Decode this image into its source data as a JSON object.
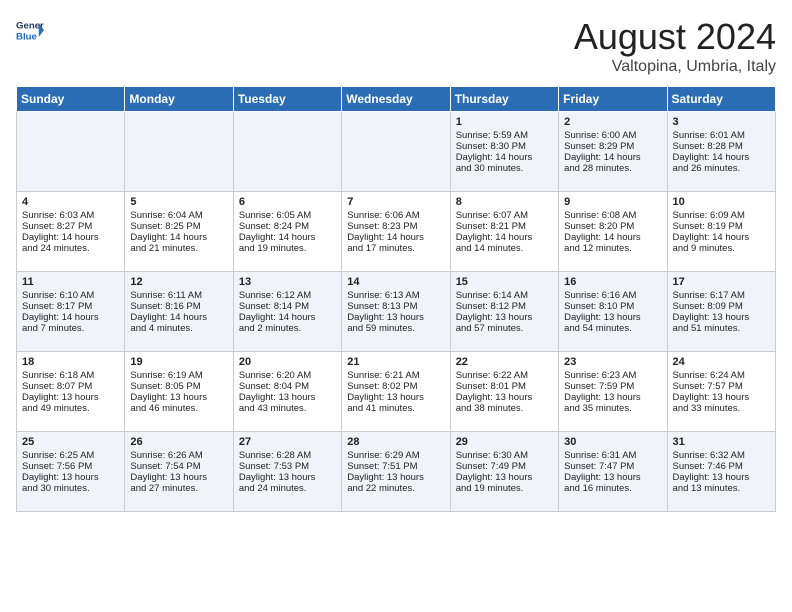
{
  "header": {
    "logo_line1": "General",
    "logo_line2": "Blue",
    "title": "August 2024",
    "subtitle": "Valtopina, Umbria, Italy"
  },
  "weekdays": [
    "Sunday",
    "Monday",
    "Tuesday",
    "Wednesday",
    "Thursday",
    "Friday",
    "Saturday"
  ],
  "weeks": [
    [
      {
        "day": "",
        "lines": []
      },
      {
        "day": "",
        "lines": []
      },
      {
        "day": "",
        "lines": []
      },
      {
        "day": "",
        "lines": []
      },
      {
        "day": "1",
        "lines": [
          "Sunrise: 5:59 AM",
          "Sunset: 8:30 PM",
          "Daylight: 14 hours",
          "and 30 minutes."
        ]
      },
      {
        "day": "2",
        "lines": [
          "Sunrise: 6:00 AM",
          "Sunset: 8:29 PM",
          "Daylight: 14 hours",
          "and 28 minutes."
        ]
      },
      {
        "day": "3",
        "lines": [
          "Sunrise: 6:01 AM",
          "Sunset: 8:28 PM",
          "Daylight: 14 hours",
          "and 26 minutes."
        ]
      }
    ],
    [
      {
        "day": "4",
        "lines": [
          "Sunrise: 6:03 AM",
          "Sunset: 8:27 PM",
          "Daylight: 14 hours",
          "and 24 minutes."
        ]
      },
      {
        "day": "5",
        "lines": [
          "Sunrise: 6:04 AM",
          "Sunset: 8:25 PM",
          "Daylight: 14 hours",
          "and 21 minutes."
        ]
      },
      {
        "day": "6",
        "lines": [
          "Sunrise: 6:05 AM",
          "Sunset: 8:24 PM",
          "Daylight: 14 hours",
          "and 19 minutes."
        ]
      },
      {
        "day": "7",
        "lines": [
          "Sunrise: 6:06 AM",
          "Sunset: 8:23 PM",
          "Daylight: 14 hours",
          "and 17 minutes."
        ]
      },
      {
        "day": "8",
        "lines": [
          "Sunrise: 6:07 AM",
          "Sunset: 8:21 PM",
          "Daylight: 14 hours",
          "and 14 minutes."
        ]
      },
      {
        "day": "9",
        "lines": [
          "Sunrise: 6:08 AM",
          "Sunset: 8:20 PM",
          "Daylight: 14 hours",
          "and 12 minutes."
        ]
      },
      {
        "day": "10",
        "lines": [
          "Sunrise: 6:09 AM",
          "Sunset: 8:19 PM",
          "Daylight: 14 hours",
          "and 9 minutes."
        ]
      }
    ],
    [
      {
        "day": "11",
        "lines": [
          "Sunrise: 6:10 AM",
          "Sunset: 8:17 PM",
          "Daylight: 14 hours",
          "and 7 minutes."
        ]
      },
      {
        "day": "12",
        "lines": [
          "Sunrise: 6:11 AM",
          "Sunset: 8:16 PM",
          "Daylight: 14 hours",
          "and 4 minutes."
        ]
      },
      {
        "day": "13",
        "lines": [
          "Sunrise: 6:12 AM",
          "Sunset: 8:14 PM",
          "Daylight: 14 hours",
          "and 2 minutes."
        ]
      },
      {
        "day": "14",
        "lines": [
          "Sunrise: 6:13 AM",
          "Sunset: 8:13 PM",
          "Daylight: 13 hours",
          "and 59 minutes."
        ]
      },
      {
        "day": "15",
        "lines": [
          "Sunrise: 6:14 AM",
          "Sunset: 8:12 PM",
          "Daylight: 13 hours",
          "and 57 minutes."
        ]
      },
      {
        "day": "16",
        "lines": [
          "Sunrise: 6:16 AM",
          "Sunset: 8:10 PM",
          "Daylight: 13 hours",
          "and 54 minutes."
        ]
      },
      {
        "day": "17",
        "lines": [
          "Sunrise: 6:17 AM",
          "Sunset: 8:09 PM",
          "Daylight: 13 hours",
          "and 51 minutes."
        ]
      }
    ],
    [
      {
        "day": "18",
        "lines": [
          "Sunrise: 6:18 AM",
          "Sunset: 8:07 PM",
          "Daylight: 13 hours",
          "and 49 minutes."
        ]
      },
      {
        "day": "19",
        "lines": [
          "Sunrise: 6:19 AM",
          "Sunset: 8:05 PM",
          "Daylight: 13 hours",
          "and 46 minutes."
        ]
      },
      {
        "day": "20",
        "lines": [
          "Sunrise: 6:20 AM",
          "Sunset: 8:04 PM",
          "Daylight: 13 hours",
          "and 43 minutes."
        ]
      },
      {
        "day": "21",
        "lines": [
          "Sunrise: 6:21 AM",
          "Sunset: 8:02 PM",
          "Daylight: 13 hours",
          "and 41 minutes."
        ]
      },
      {
        "day": "22",
        "lines": [
          "Sunrise: 6:22 AM",
          "Sunset: 8:01 PM",
          "Daylight: 13 hours",
          "and 38 minutes."
        ]
      },
      {
        "day": "23",
        "lines": [
          "Sunrise: 6:23 AM",
          "Sunset: 7:59 PM",
          "Daylight: 13 hours",
          "and 35 minutes."
        ]
      },
      {
        "day": "24",
        "lines": [
          "Sunrise: 6:24 AM",
          "Sunset: 7:57 PM",
          "Daylight: 13 hours",
          "and 33 minutes."
        ]
      }
    ],
    [
      {
        "day": "25",
        "lines": [
          "Sunrise: 6:25 AM",
          "Sunset: 7:56 PM",
          "Daylight: 13 hours",
          "and 30 minutes."
        ]
      },
      {
        "day": "26",
        "lines": [
          "Sunrise: 6:26 AM",
          "Sunset: 7:54 PM",
          "Daylight: 13 hours",
          "and 27 minutes."
        ]
      },
      {
        "day": "27",
        "lines": [
          "Sunrise: 6:28 AM",
          "Sunset: 7:53 PM",
          "Daylight: 13 hours",
          "and 24 minutes."
        ]
      },
      {
        "day": "28",
        "lines": [
          "Sunrise: 6:29 AM",
          "Sunset: 7:51 PM",
          "Daylight: 13 hours",
          "and 22 minutes."
        ]
      },
      {
        "day": "29",
        "lines": [
          "Sunrise: 6:30 AM",
          "Sunset: 7:49 PM",
          "Daylight: 13 hours",
          "and 19 minutes."
        ]
      },
      {
        "day": "30",
        "lines": [
          "Sunrise: 6:31 AM",
          "Sunset: 7:47 PM",
          "Daylight: 13 hours",
          "and 16 minutes."
        ]
      },
      {
        "day": "31",
        "lines": [
          "Sunrise: 6:32 AM",
          "Sunset: 7:46 PM",
          "Daylight: 13 hours",
          "and 13 minutes."
        ]
      }
    ]
  ]
}
